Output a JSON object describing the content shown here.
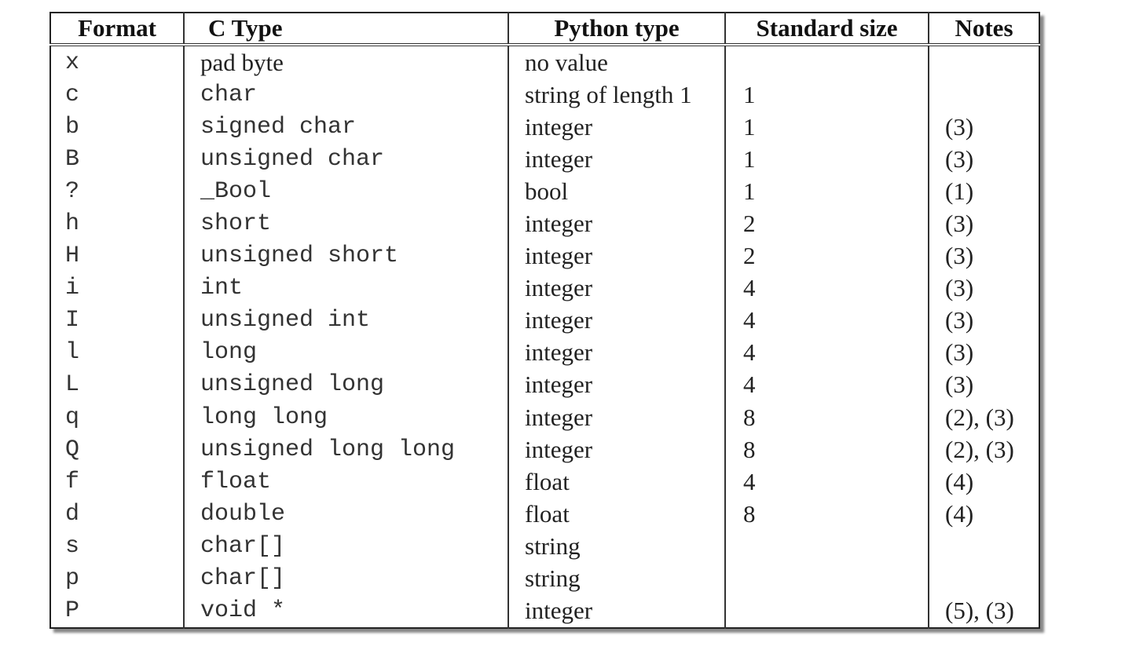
{
  "headers": [
    "Format",
    "C Type",
    "Python type",
    "Standard size",
    "Notes"
  ],
  "rows": [
    [
      "x",
      "pad byte",
      "no value",
      "",
      ""
    ],
    [
      "c",
      "char",
      "string of length 1",
      "1",
      ""
    ],
    [
      "b",
      "signed char",
      "integer",
      "1",
      "(3)"
    ],
    [
      "B",
      "unsigned char",
      "integer",
      "1",
      "(3)"
    ],
    [
      "?",
      "_Bool",
      "bool",
      "1",
      "(1)"
    ],
    [
      "h",
      "short",
      "integer",
      "2",
      "(3)"
    ],
    [
      "H",
      "unsigned short",
      "integer",
      "2",
      "(3)"
    ],
    [
      "i",
      "int",
      "integer",
      "4",
      "(3)"
    ],
    [
      "I",
      "unsigned int",
      "integer",
      "4",
      "(3)"
    ],
    [
      "l",
      "long",
      "integer",
      "4",
      "(3)"
    ],
    [
      "L",
      "unsigned long",
      "integer",
      "4",
      "(3)"
    ],
    [
      "q",
      "long long",
      "integer",
      "8",
      "(2), (3)"
    ],
    [
      "Q",
      "unsigned long long",
      "integer",
      "8",
      "(2), (3)"
    ],
    [
      "f",
      "float",
      "float",
      "4",
      "(4)"
    ],
    [
      "d",
      "double",
      "float",
      "8",
      "(4)"
    ],
    [
      "s",
      "char[]",
      "string",
      "",
      ""
    ],
    [
      "p",
      "char[]",
      "string",
      "",
      ""
    ],
    [
      "P",
      "void *",
      "integer",
      "",
      "(5), (3)"
    ]
  ]
}
